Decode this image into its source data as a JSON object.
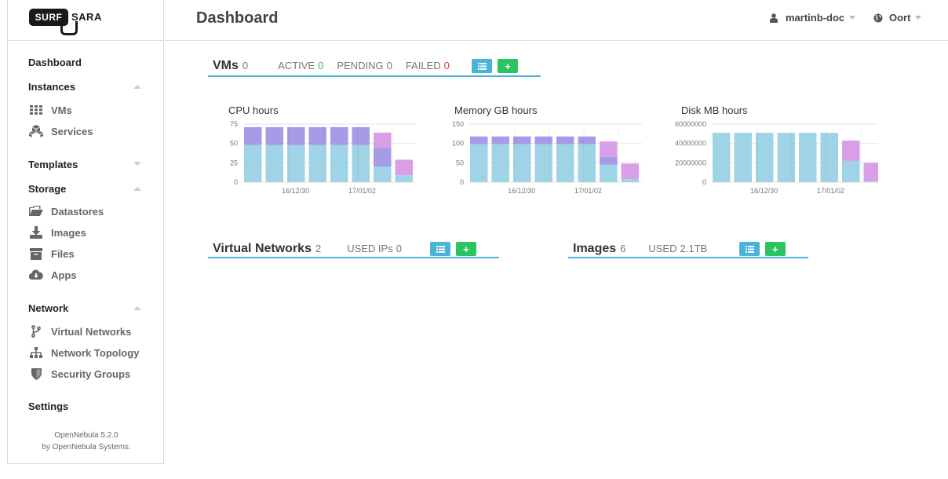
{
  "brand": {
    "left": "SURF",
    "right": "SARA"
  },
  "header": {
    "title": "Dashboard",
    "user": "martinb-doc",
    "zone": "Oort"
  },
  "sidebar": {
    "dashboard": "Dashboard",
    "instances": {
      "label": "Instances",
      "items": [
        {
          "label": "VMs",
          "icon": "grid-icon"
        },
        {
          "label": "Services",
          "icon": "cubes-icon"
        }
      ]
    },
    "templates": {
      "label": "Templates"
    },
    "storage": {
      "label": "Storage",
      "items": [
        {
          "label": "Datastores",
          "icon": "folder-icon"
        },
        {
          "label": "Images",
          "icon": "download-icon"
        },
        {
          "label": "Files",
          "icon": "archive-icon"
        },
        {
          "label": "Apps",
          "icon": "cloud-download-icon"
        }
      ]
    },
    "network": {
      "label": "Network",
      "items": [
        {
          "label": "Virtual Networks",
          "icon": "branch-icon"
        },
        {
          "label": "Network Topology",
          "icon": "sitemap-icon"
        },
        {
          "label": "Security Groups",
          "icon": "shield-icon"
        }
      ]
    },
    "settings": "Settings",
    "footer": {
      "version": "OpenNebula 5.2.0",
      "by": "by OpenNebula Systems."
    }
  },
  "vms_panel": {
    "title": "VMs",
    "count": "0",
    "active_label": "ACTIVE",
    "active": "0",
    "pending_label": "PENDING",
    "pending": "0",
    "failed_label": "FAILED",
    "failed": "0"
  },
  "vnets_panel": {
    "title": "Virtual Networks",
    "count": "2",
    "used_label": "USED IPs",
    "used": "0"
  },
  "images_panel": {
    "title": "Images",
    "count": "6",
    "used_label": "USED",
    "used": "2.1TB"
  },
  "colors": {
    "accent": "#4fb3d9",
    "green": "#2bc45e",
    "bar_blue": "#9fd4e6",
    "bar_purple": "#a59be6",
    "bar_pink": "#d89ee6"
  },
  "chart_data": [
    {
      "type": "bar",
      "title": "CPU hours",
      "ylim": [
        0,
        75
      ],
      "yticks": [
        "75",
        "50",
        "25",
        "0"
      ],
      "xticks": [
        "16/12/30",
        "17/01/02"
      ],
      "series": [
        {
          "values": [
            48,
            48,
            48,
            48,
            48,
            48,
            20,
            9
          ]
        },
        {
          "values": [
            23,
            23,
            23,
            23,
            23,
            23,
            24,
            0
          ]
        },
        {
          "values": [
            0,
            0,
            0,
            0,
            0,
            0,
            20,
            20
          ]
        }
      ]
    },
    {
      "type": "bar",
      "title": "Memory GB hours",
      "ylim": [
        0,
        150
      ],
      "yticks": [
        "150",
        "100",
        "50",
        "0"
      ],
      "xticks": [
        "16/12/30",
        "17/01/02"
      ],
      "series": [
        {
          "values": [
            98,
            98,
            98,
            98,
            98,
            98,
            45,
            8
          ]
        },
        {
          "values": [
            20,
            20,
            20,
            20,
            20,
            20,
            20,
            0
          ]
        },
        {
          "values": [
            0,
            0,
            0,
            0,
            0,
            0,
            40,
            40
          ]
        }
      ]
    },
    {
      "type": "bar",
      "title": "Disk MB hours",
      "ylim": [
        0,
        60000000
      ],
      "yticks": [
        "60000000",
        "40000000",
        "20000000",
        "0"
      ],
      "xticks": [
        "16/12/30",
        "17/01/02"
      ],
      "series": [
        {
          "values": [
            51000000,
            51000000,
            51000000,
            51000000,
            51000000,
            51000000,
            22000000,
            1000000
          ]
        },
        {
          "values": [
            0,
            0,
            0,
            0,
            0,
            0,
            0,
            0
          ]
        },
        {
          "values": [
            0,
            0,
            0,
            0,
            0,
            0,
            21000000,
            19000000
          ]
        }
      ]
    }
  ]
}
